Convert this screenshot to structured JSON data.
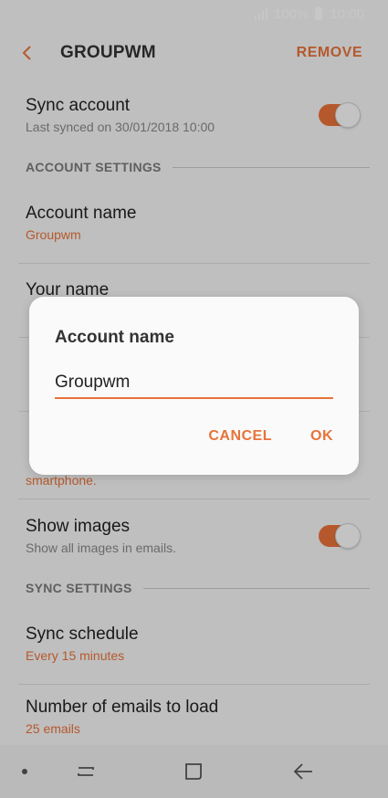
{
  "status_bar": {
    "battery": "100%",
    "time": "10:00"
  },
  "app_bar": {
    "title": "GROUPWM",
    "action": "REMOVE"
  },
  "rows": {
    "sync_account": {
      "title": "Sync account",
      "sub": "Last synced on 30/01/2018  10:00",
      "toggle_on": true
    },
    "account_name": {
      "title": "Account name",
      "sub": "Groupwm"
    },
    "your_name": {
      "title": "Your name"
    },
    "show_images": {
      "title": "Show images",
      "sub": "Show all images in emails.",
      "toggle_on": true
    },
    "sync_schedule": {
      "title": "Sync schedule",
      "sub": "Every 15 minutes"
    },
    "emails_to_load": {
      "title": "Number of emails to load",
      "sub": "25 emails"
    },
    "signature_fragment": {
      "sub": "smartphone."
    }
  },
  "sections": {
    "account_settings": "ACCOUNT SETTINGS",
    "sync_settings": "SYNC SETTINGS"
  },
  "dialog": {
    "title": "Account name",
    "value": "Groupwm",
    "cancel": "CANCEL",
    "ok": "OK"
  },
  "colors": {
    "accent": "#e8733a"
  }
}
